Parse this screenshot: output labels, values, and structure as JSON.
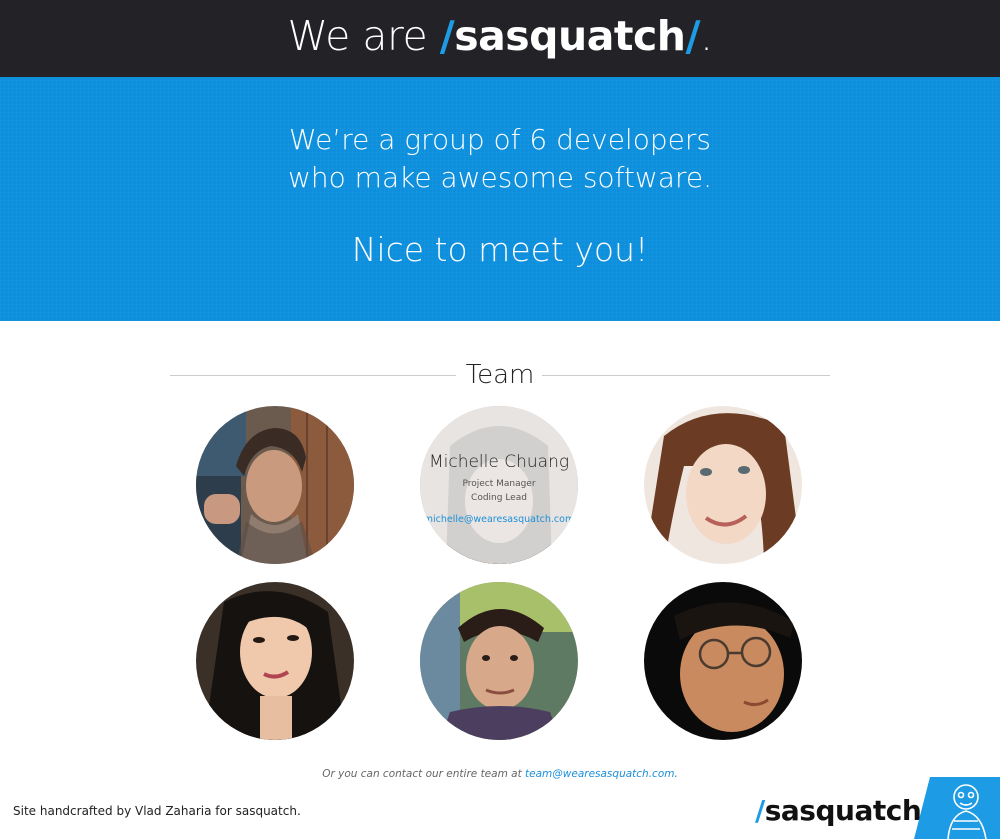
{
  "header": {
    "prefix": "We are ",
    "slash_open": "/",
    "brand": "sasquatch",
    "slash_close": "/",
    "suffix": "."
  },
  "hero": {
    "line1": "We’re a group of 6 developers",
    "line2": "who make awesome software.",
    "greeting": "Nice to meet you!"
  },
  "team": {
    "heading": "Team",
    "members": [
      {
        "photo": "team-member-1-photo"
      },
      {
        "name": "Michelle Chuang",
        "role1": "Project Manager",
        "role2": "Coding Lead",
        "email": "michelle@wearesasquatch.com"
      },
      {
        "photo": "team-member-3-photo"
      },
      {
        "photo": "team-member-4-photo"
      },
      {
        "photo": "team-member-5-photo"
      },
      {
        "photo": "team-member-6-photo"
      }
    ]
  },
  "contact": {
    "text": "Or you can contact our entire team at ",
    "email": "team@wearesasquatch.com",
    "end": "."
  },
  "footer": {
    "credit": "Site handcrafted by Vlad Zaharia for sasquatch.",
    "logo_slash_open": "/",
    "logo_brand": "sasquatch",
    "logo_slash_close": "/",
    "mascot_icon": "sasquatch-mascot-icon"
  },
  "colors": {
    "header_bg": "#232327",
    "hero_bg": "#0d8fdd",
    "accent": "#1d9be4",
    "link": "#1d8fd8"
  }
}
